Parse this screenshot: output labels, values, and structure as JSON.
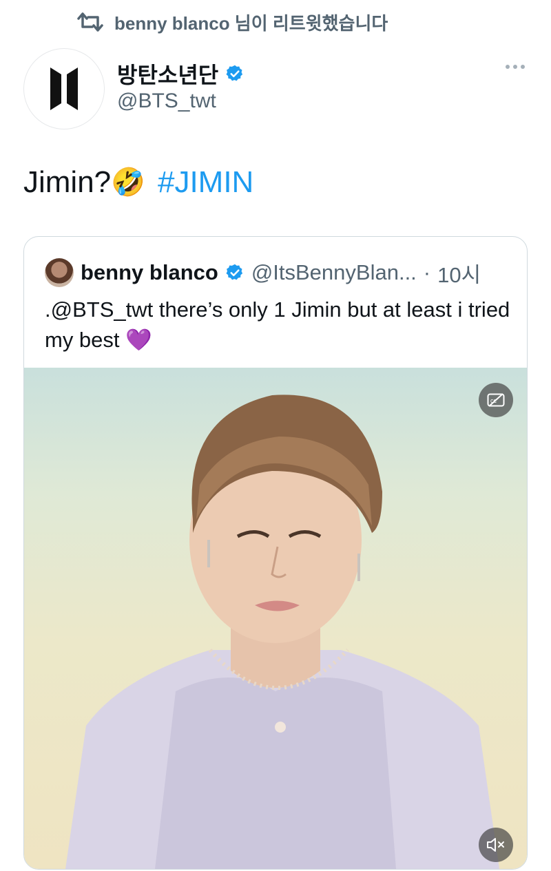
{
  "retweet": {
    "icon": "retweet-icon",
    "label": "benny blanco 님이 리트윗했습니다"
  },
  "tweet": {
    "avatar_icon": "bts-logo-icon",
    "author_name": "방탄소년단",
    "verified_icon": "verified-badge-icon",
    "author_handle": "@BTS_twt",
    "more_icon": "more-options-icon",
    "text": "Jimin?",
    "emoji": "🤣",
    "hashtag": "#JIMIN",
    "accent_color": "#1d9bf0"
  },
  "quote": {
    "author_name": "benny blanco",
    "author_handle": "@ItsBennyBlan...",
    "separator": "·",
    "time": "10시",
    "text": ".@BTS_twt there’s only 1 Jimin but at least i tried my best",
    "emoji": "💜"
  },
  "media": {
    "type": "video",
    "cc_icon": "closed-captions-icon",
    "mute_icon": "volume-muted-icon"
  }
}
